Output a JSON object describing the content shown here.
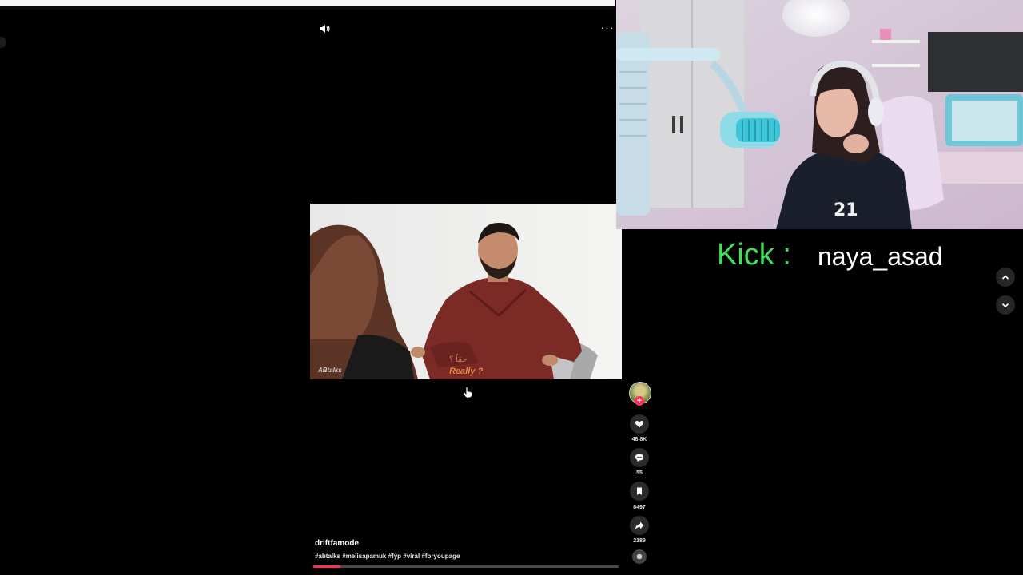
{
  "browser": {
    "top_strip_color": "#f6f6f8"
  },
  "player": {
    "volume_icon": "speaker-icon",
    "more_icon": "more-horizontal-icon",
    "more_glyph": "···",
    "video": {
      "subtitle_arabic": "حقاً ؟",
      "subtitle_english": "Really ?",
      "watermark": "ABtalks"
    },
    "caption": {
      "username": "driftfamode",
      "hashtags": "#abtalks #melisapamuk #fyp #viral #foryoupage"
    },
    "progress": 0.09,
    "progress_color": "#fe2c55"
  },
  "actions": {
    "follow_glyph": "+",
    "like": {
      "icon": "heart-icon",
      "count": "48.8K"
    },
    "comment": {
      "icon": "comment-icon",
      "count": "55"
    },
    "save": {
      "icon": "bookmark-icon",
      "count": "8497"
    },
    "share": {
      "icon": "share-arrow-icon",
      "count": "2189"
    },
    "sound": {
      "icon": "music-disc-icon"
    }
  },
  "overlay": {
    "kick_label": "Kick :",
    "kick_name": "naya_asad",
    "kick_color": "#3ee05b"
  },
  "navigation": {
    "prev_icon": "chevron-up-icon",
    "next_icon": "chevron-down-icon"
  }
}
